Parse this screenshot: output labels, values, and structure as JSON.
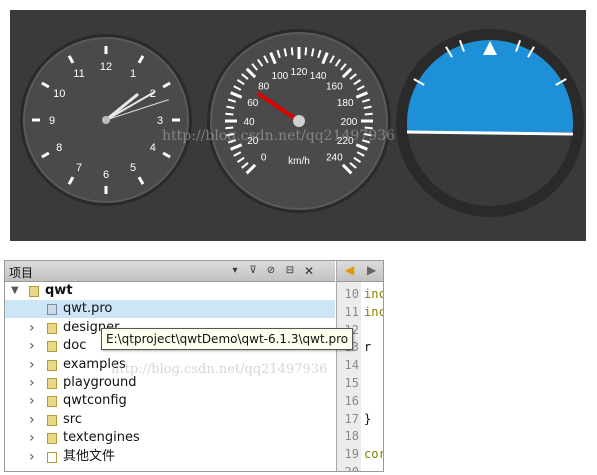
{
  "gauges": {
    "clock": {
      "numbers": [
        "12",
        "1",
        "2",
        "3",
        "4",
        "5",
        "6",
        "7",
        "8",
        "9",
        "10",
        "11"
      ],
      "hour": 1.7,
      "minute": 10,
      "second": 12
    },
    "speedometer": {
      "ticks": [
        "0",
        "20",
        "40",
        "60",
        "80",
        "100",
        "120",
        "140",
        "160",
        "180",
        "200",
        "220",
        "240"
      ],
      "unit": "km/h",
      "value": 70,
      "min": 0,
      "max": 240,
      "needle_color": "#e00000"
    },
    "attitude": {
      "sky_color": "#1e90d8",
      "ground_color": "#3a3a3a",
      "horizon_color": "#ffffff"
    },
    "watermark": "http://blog.csdn.net/qq21497936"
  },
  "ide": {
    "header_title": "项目",
    "tree": [
      {
        "label": "qwt",
        "level": 0,
        "expanded": true,
        "type": "project"
      },
      {
        "label": "qwt.pro",
        "level": 1,
        "type": "file",
        "selected": true
      },
      {
        "label": "designer",
        "level": 1,
        "type": "folder"
      },
      {
        "label": "doc",
        "level": 1,
        "type": "folder"
      },
      {
        "label": "examples",
        "level": 1,
        "type": "folder"
      },
      {
        "label": "playground",
        "level": 1,
        "type": "folder"
      },
      {
        "label": "qwtconfig",
        "level": 1,
        "type": "folder"
      },
      {
        "label": "src",
        "level": 1,
        "type": "folder"
      },
      {
        "label": "textengines",
        "level": 1,
        "type": "folder"
      },
      {
        "label": "其他文件",
        "level": 1,
        "type": "doc"
      }
    ],
    "tooltip": "E:\\qtproject\\qwtDemo\\qwt-6.1.3\\qwt.pro",
    "line_numbers": [
      "10",
      "11",
      "12",
      "13",
      "14",
      "15",
      "16",
      "17",
      "18",
      "19",
      "20"
    ],
    "code_lines": [
      "inc",
      "inc",
      "",
      "r",
      "",
      "",
      "",
      "}",
      "",
      "cor",
      "",
      ""
    ],
    "watermark": "http://blog.csdn.net/qq21497936"
  }
}
